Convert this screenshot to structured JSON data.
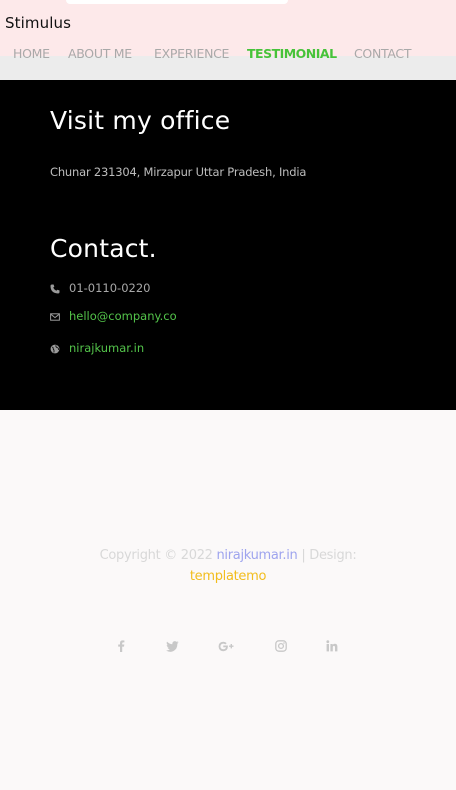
{
  "header": {
    "brand": "Stimulus",
    "nav": [
      {
        "label": "HOME",
        "active": false
      },
      {
        "label": "ABOUT ME",
        "active": false
      },
      {
        "label": "EXPERIENCE",
        "active": false
      },
      {
        "label": "TESTIMONIAL",
        "active": true
      },
      {
        "label": "CONTACT",
        "active": false
      }
    ]
  },
  "office": {
    "heading": "Visit my office",
    "address": "Chunar 231304, Mirzapur Uttar Pradesh, India"
  },
  "contact": {
    "heading": "Contact.",
    "phone": "01-0110-0220",
    "email": "hello@company.co",
    "website": "nirajkumar.in"
  },
  "footer": {
    "copyright_prefix": "Copyright © 2022",
    "author_link": "nirajkumar.in",
    "design_sep": "| Design:",
    "design_link": "templatemo"
  },
  "social_icons": [
    "facebook-icon",
    "twitter-icon",
    "google-plus-icon",
    "instagram-icon",
    "linkedin-icon"
  ],
  "colors": {
    "accent_green": "#46c33a",
    "link_green": "#53c34a",
    "link_blue": "#9ea4ee",
    "link_yellow": "#f2bd1d",
    "header_bg": "#fde9ea",
    "dark_bg": "#000000"
  }
}
